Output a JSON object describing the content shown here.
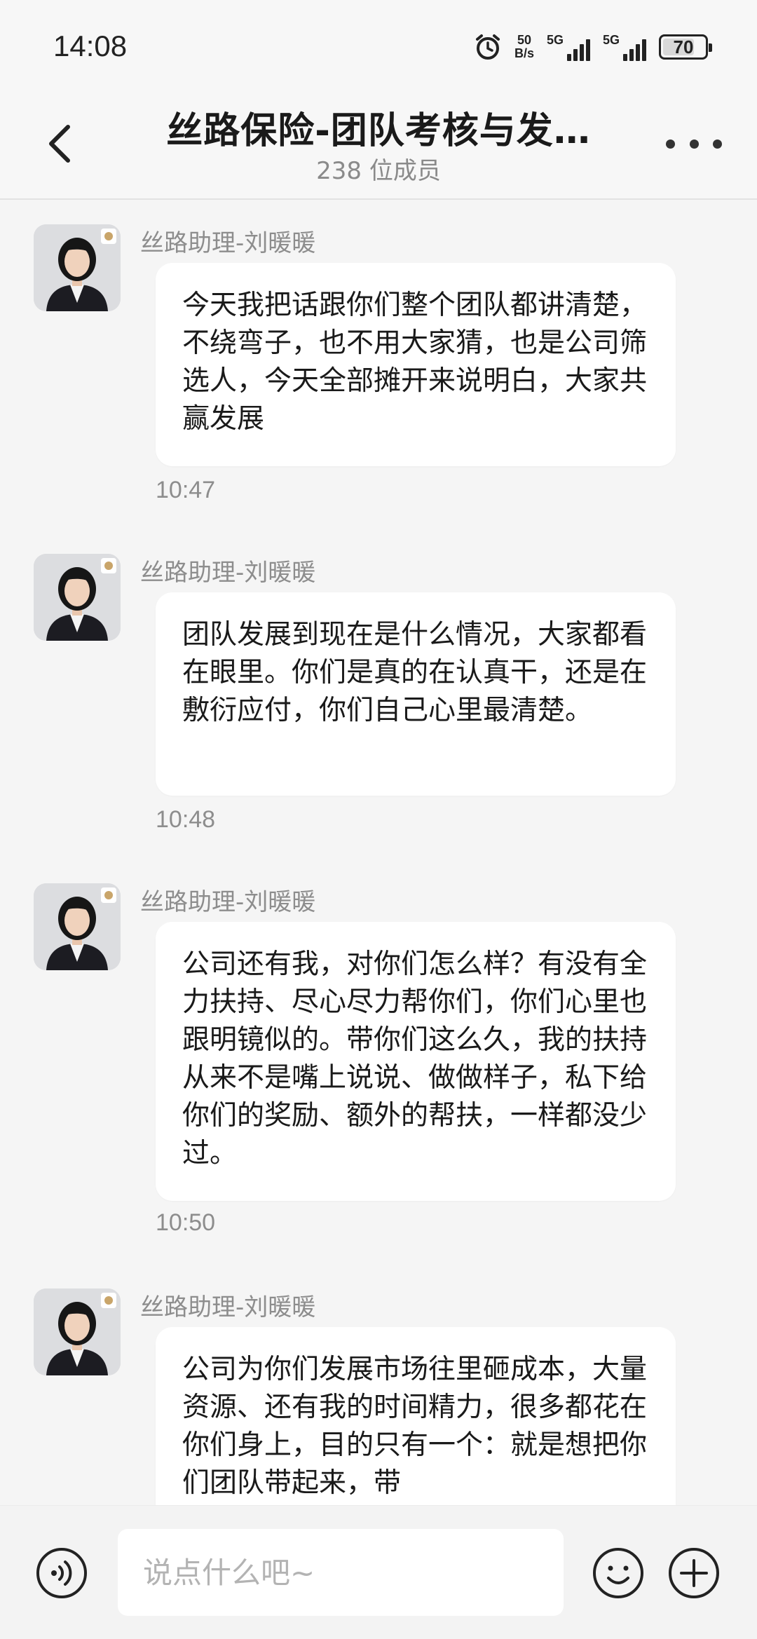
{
  "status_bar": {
    "time": "14:08",
    "net_speed_value": "50",
    "net_speed_unit": "B/s",
    "sim1": "5G",
    "sim2": "5G",
    "battery": "70",
    "icons": [
      "alarm-icon",
      "signal-icon",
      "battery-icon"
    ]
  },
  "header": {
    "title": "丝路保险-团队考核与发…",
    "subtitle": "238 位成员"
  },
  "messages": [
    {
      "sender": "丝路助理-刘暖暖",
      "text": "今天我把话跟你们整个团队都讲清楚，不绕弯子，也不用大家猜，也是公司筛选人，今天全部摊开来说明白，大家共赢发展",
      "time": "10:47"
    },
    {
      "sender": "丝路助理-刘暖暖",
      "text": "团队发展到现在是什么情况，大家都看在眼里。你们是真的在认真干，还是在敷衍应付，你们自己心里最清楚。",
      "time": "10:48"
    },
    {
      "sender": "丝路助理-刘暖暖",
      "text": "公司还有我，对你们怎么样？有没有全力扶持、尽心尽力帮你们，你们心里也跟明镜似的。带你们这么久，我的扶持从来不是嘴上说说、做做样子，私下给你们的奖励、额外的帮扶，一样都没少过。",
      "time": "10:50"
    },
    {
      "sender": "丝路助理-刘暖暖",
      "text": "公司为你们发展市场往里砸成本，大量资源、还有我的时间精力，很多都花在你们身上，目的只有一个：就是想把你们团队带起来，带",
      "time": ""
    }
  ],
  "input": {
    "placeholder": "说点什么吧~"
  },
  "colors": {
    "background": "#f5f5f5",
    "bubble": "#ffffff",
    "muted_text": "#8d8d8d"
  }
}
